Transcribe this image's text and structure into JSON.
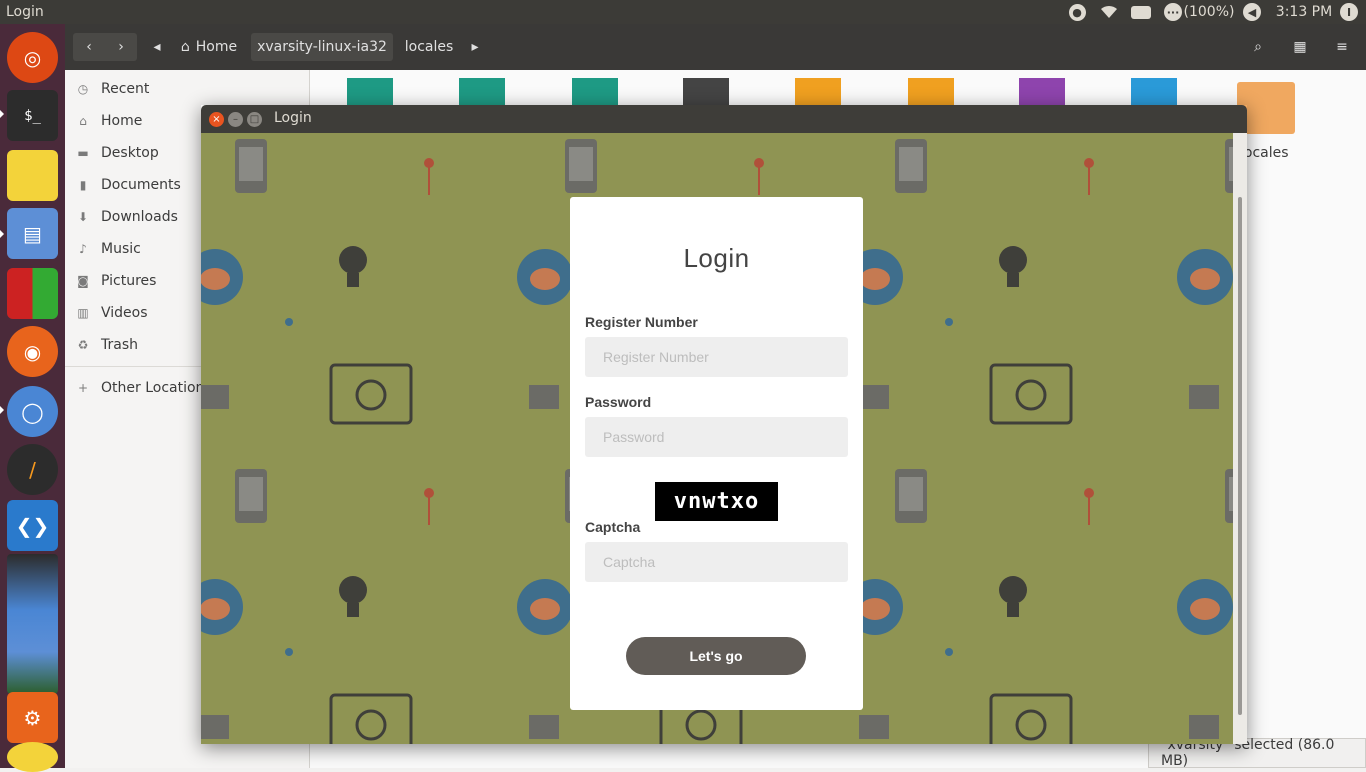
{
  "topbar": {
    "title": "Login",
    "battery_percent": "(100%)",
    "time": "3:13 PM"
  },
  "launcher": {
    "items": [
      "ubuntu-icon",
      "terminal-icon",
      "sticky-notes-icon",
      "file-cabinet-icon",
      "rubiks-cube-icon",
      "firefox-icon",
      "chromium-icon",
      "sublime-text-icon",
      "vscode-icon",
      "stacked-apps-icon",
      "software-updater-icon",
      "wallet-icon"
    ]
  },
  "nautilus": {
    "breadcrumbs": [
      "Home",
      "xvarsity-linux-ia32",
      "locales"
    ],
    "sidebar": [
      {
        "label": "Recent",
        "icon": "clock-icon"
      },
      {
        "label": "Home",
        "icon": "home-icon"
      },
      {
        "label": "Desktop",
        "icon": "desktop-icon"
      },
      {
        "label": "Documents",
        "icon": "document-icon"
      },
      {
        "label": "Downloads",
        "icon": "download-icon"
      },
      {
        "label": "Music",
        "icon": "music-icon"
      },
      {
        "label": "Pictures",
        "icon": "camera-icon"
      },
      {
        "label": "Videos",
        "icon": "film-icon"
      },
      {
        "label": "Trash",
        "icon": "recycle-icon"
      }
    ],
    "other_locations": "Other Locations",
    "folder_label": "locales",
    "status": "\"xvarsity\" selected  (86.0 MB)"
  },
  "window": {
    "title": "Login"
  },
  "login": {
    "heading": "Login",
    "register_label": "Register Number",
    "register_placeholder": "Register Number",
    "password_label": "Password",
    "password_placeholder": "Password",
    "captcha_text": "vnwtxo",
    "captcha_label": "Captcha",
    "captcha_placeholder": "Captcha",
    "submit_label": "Let's go"
  }
}
